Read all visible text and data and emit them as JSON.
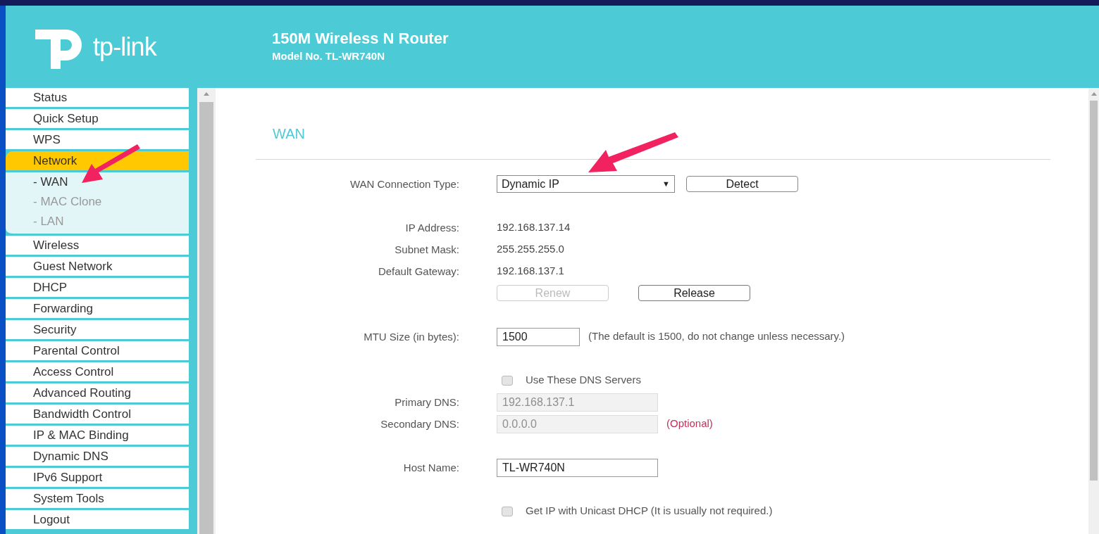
{
  "header": {
    "logo_text": "tp-link",
    "title": "150M Wireless N Router",
    "model": "Model No. TL-WR740N"
  },
  "sidebar": {
    "items": [
      {
        "label": "Status",
        "selected": false
      },
      {
        "label": "Quick Setup",
        "selected": false
      },
      {
        "label": "WPS",
        "selected": false
      },
      {
        "label": "Network",
        "selected": true,
        "expanded": true,
        "children": [
          {
            "label": "- WAN",
            "selected": true
          },
          {
            "label": "- MAC Clone",
            "selected": false
          },
          {
            "label": "- LAN",
            "selected": false
          }
        ]
      },
      {
        "label": "Wireless",
        "selected": false
      },
      {
        "label": "Guest Network",
        "selected": false
      },
      {
        "label": "DHCP",
        "selected": false
      },
      {
        "label": "Forwarding",
        "selected": false
      },
      {
        "label": "Security",
        "selected": false
      },
      {
        "label": "Parental Control",
        "selected": false
      },
      {
        "label": "Access Control",
        "selected": false
      },
      {
        "label": "Advanced Routing",
        "selected": false
      },
      {
        "label": "Bandwidth Control",
        "selected": false
      },
      {
        "label": "IP & MAC Binding",
        "selected": false
      },
      {
        "label": "Dynamic DNS",
        "selected": false
      },
      {
        "label": "IPv6 Support",
        "selected": false
      },
      {
        "label": "System Tools",
        "selected": false
      },
      {
        "label": "Logout",
        "selected": false
      }
    ]
  },
  "content": {
    "heading": "WAN",
    "sections": [
      [
        {
          "kind": "select",
          "label": "WAN Connection Type:",
          "value": "Dynamic IP",
          "caret": "▼",
          "button": "Detect"
        }
      ],
      [
        {
          "kind": "info",
          "label": "IP Address:",
          "value": "192.168.137.14"
        },
        {
          "kind": "info",
          "label": "Subnet Mask:",
          "value": "255.255.255.0"
        },
        {
          "kind": "info",
          "label": "Default Gateway:",
          "value": "192.168.137.1"
        },
        {
          "kind": "buttons",
          "buttons": [
            {
              "label": "Renew",
              "disabled": true
            },
            {
              "label": "Release",
              "disabled": false
            }
          ]
        }
      ],
      [
        {
          "kind": "short-input",
          "label": "MTU Size (in bytes):",
          "value": "1500",
          "disabled": false,
          "note": {
            "text": "(The default is 1500, do not change unless necessary.)",
            "kind": "hint"
          }
        }
      ],
      [
        {
          "kind": "checkbox",
          "label": "Use These DNS Servers",
          "checked": false
        },
        {
          "kind": "input",
          "label": "Primary DNS:",
          "value": "192.168.137.1",
          "disabled": true
        },
        {
          "kind": "input",
          "label": "Secondary DNS:",
          "value": "0.0.0.0",
          "disabled": true,
          "note": {
            "text": "(Optional)",
            "kind": "optional"
          }
        }
      ],
      [
        {
          "kind": "input",
          "label": "Host Name:",
          "value": "TL-WR740N",
          "disabled": false
        }
      ],
      [
        {
          "kind": "checkbox",
          "label": "Get IP with Unicast DHCP (It is usually not required.)",
          "checked": false
        }
      ]
    ]
  }
}
